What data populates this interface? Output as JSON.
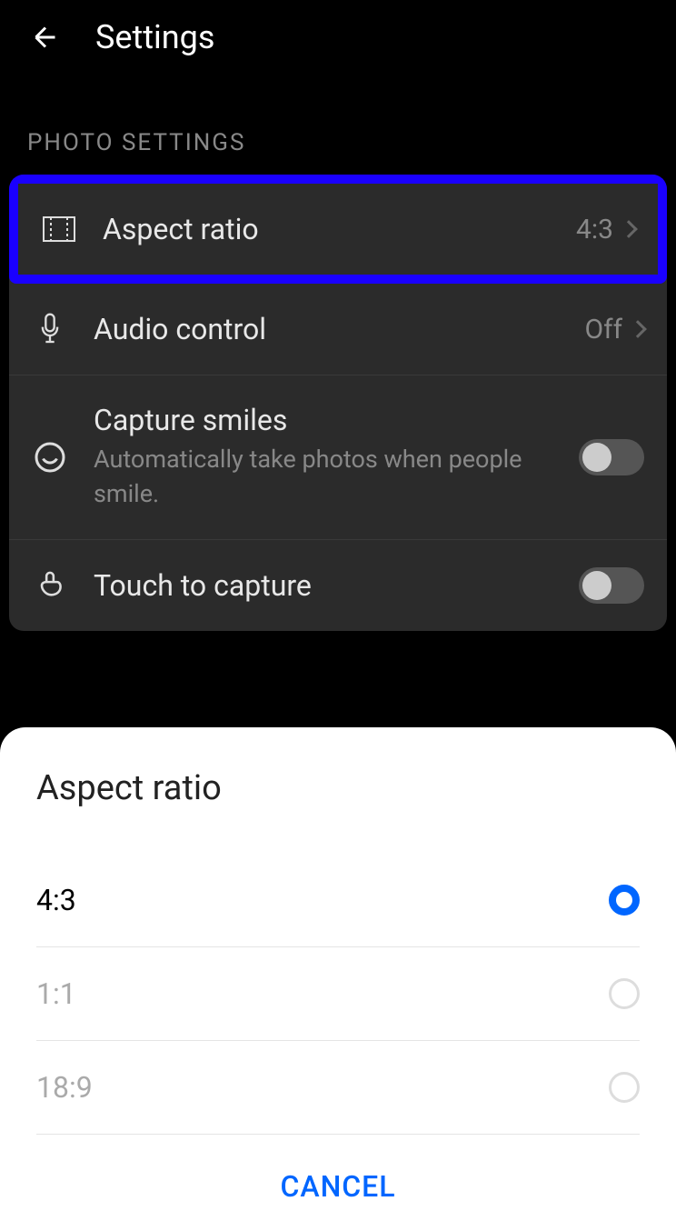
{
  "header": {
    "title": "Settings"
  },
  "photo_section": {
    "label": "PHOTO SETTINGS",
    "rows": {
      "aspect_ratio": {
        "title": "Aspect ratio",
        "value": "4:3"
      },
      "audio_control": {
        "title": "Audio control",
        "value": "Off"
      },
      "capture_smiles": {
        "title": "Capture smiles",
        "subtitle": "Automatically take photos when people smile."
      },
      "touch_capture": {
        "title": "Touch to capture"
      }
    }
  },
  "dialog": {
    "title": "Aspect ratio",
    "options": {
      "opt1": "4:3",
      "opt2": "1:1",
      "opt3": "18:9"
    },
    "cancel": "CANCEL"
  }
}
